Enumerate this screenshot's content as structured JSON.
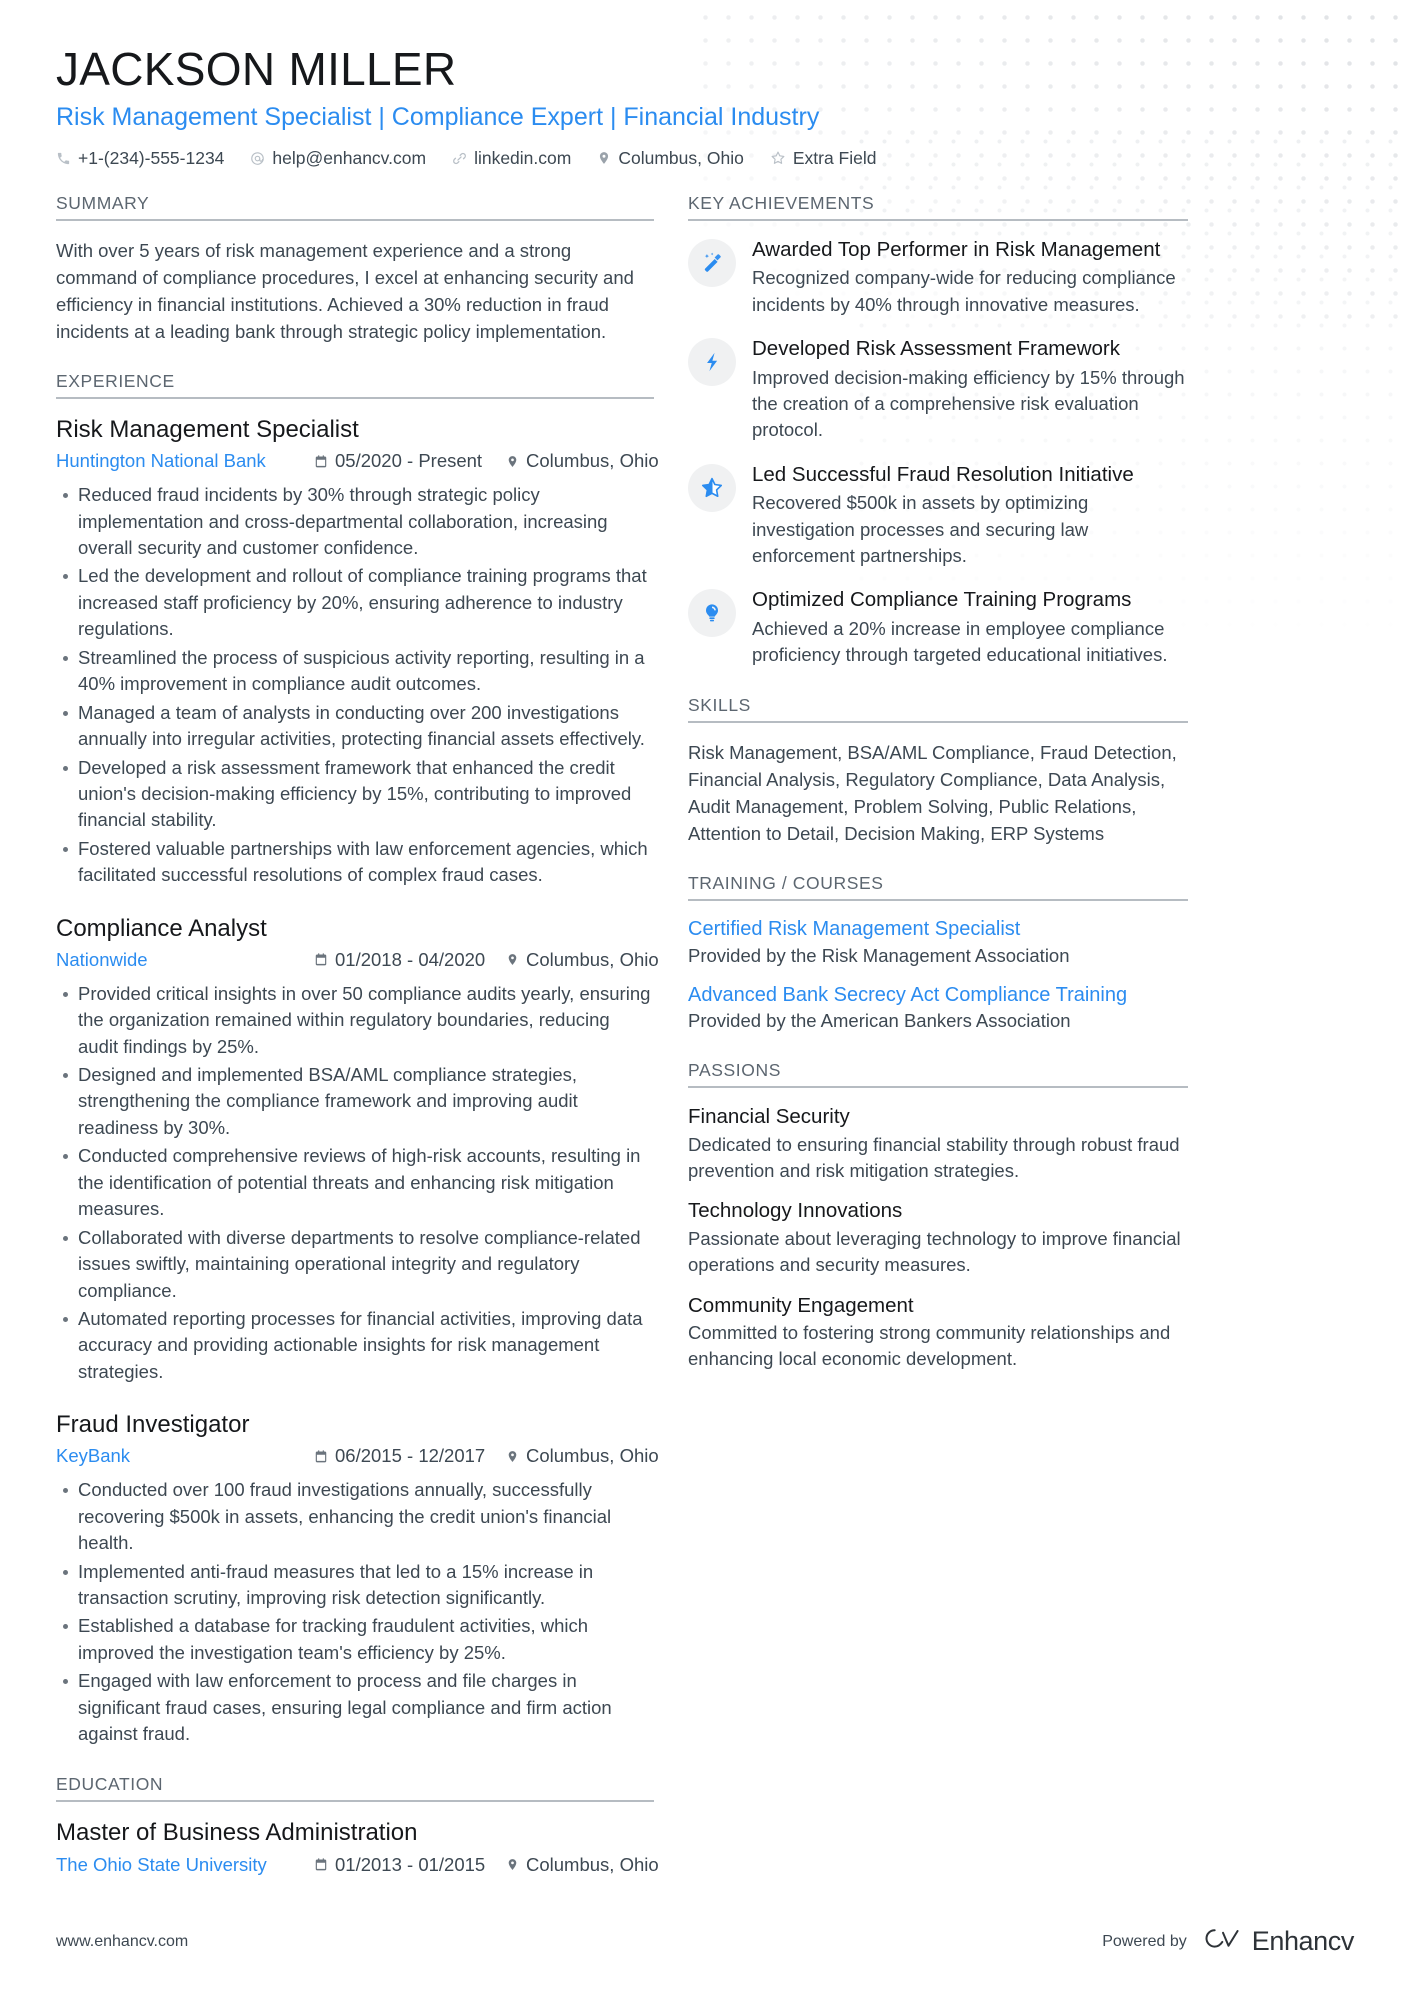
{
  "header": {
    "name": "JACKSON MILLER",
    "headline": "Risk Management Specialist | Compliance Expert | Financial Industry",
    "contacts": [
      {
        "icon": "phone-icon",
        "text": "+1-(234)-555-1234"
      },
      {
        "icon": "email-icon",
        "text": "help@enhancv.com"
      },
      {
        "icon": "link-icon",
        "text": "linkedin.com"
      },
      {
        "icon": "location-pin-icon",
        "text": "Columbus, Ohio"
      },
      {
        "icon": "star-outline-icon",
        "text": "Extra Field"
      }
    ]
  },
  "sections": {
    "summary": {
      "heading": "SUMMARY",
      "text": "With over 5 years of risk management experience and a strong command of compliance procedures, I excel at enhancing security and efficiency in financial institutions. Achieved a 30% reduction in fraud incidents at a leading bank through strategic policy implementation."
    },
    "experience": {
      "heading": "EXPERIENCE",
      "jobs": [
        {
          "title": "Risk Management Specialist",
          "company": "Huntington National Bank",
          "dates": "05/2020 - Present",
          "location": "Columbus, Ohio",
          "bullets": [
            "Reduced fraud incidents by 30% through strategic policy implementation and cross-departmental collaboration, increasing overall security and customer confidence.",
            "Led the development and rollout of compliance training programs that increased staff proficiency by 20%, ensuring adherence to industry regulations.",
            "Streamlined the process of suspicious activity reporting, resulting in a 40% improvement in compliance audit outcomes.",
            "Managed a team of analysts in conducting over 200 investigations annually into irregular activities, protecting financial assets effectively.",
            "Developed a risk assessment framework that enhanced the credit union's decision-making efficiency by 15%, contributing to improved financial stability.",
            "Fostered valuable partnerships with law enforcement agencies, which facilitated successful resolutions of complex fraud cases."
          ]
        },
        {
          "title": "Compliance Analyst",
          "company": "Nationwide",
          "dates": "01/2018 - 04/2020",
          "location": "Columbus, Ohio",
          "bullets": [
            "Provided critical insights in over 50 compliance audits yearly, ensuring the organization remained within regulatory boundaries, reducing audit findings by 25%.",
            "Designed and implemented BSA/AML compliance strategies, strengthening the compliance framework and improving audit readiness by 30%.",
            "Conducted comprehensive reviews of high-risk accounts, resulting in the identification of potential threats and enhancing risk mitigation measures.",
            "Collaborated with diverse departments to resolve compliance-related issues swiftly, maintaining operational integrity and regulatory compliance.",
            "Automated reporting processes for financial activities, improving data accuracy and providing actionable insights for risk management strategies."
          ]
        },
        {
          "title": "Fraud Investigator",
          "company": "KeyBank",
          "dates": "06/2015 - 12/2017",
          "location": "Columbus, Ohio",
          "bullets": [
            "Conducted over 100 fraud investigations annually, successfully recovering $500k in assets, enhancing the credit union's financial health.",
            "Implemented anti-fraud measures that led to a 15% increase in transaction scrutiny, improving risk detection significantly.",
            "Established a database for tracking fraudulent activities, which improved the investigation team's efficiency by 25%.",
            "Engaged with law enforcement to process and file charges in significant fraud cases, ensuring legal compliance and firm action against fraud."
          ]
        }
      ]
    },
    "education": {
      "heading": "EDUCATION",
      "entries": [
        {
          "degree": "Master of Business Administration",
          "school": "The Ohio State University",
          "dates": "01/2013 - 01/2015",
          "location": "Columbus, Ohio"
        }
      ]
    },
    "key_achievements": {
      "heading": "KEY ACHIEVEMENTS",
      "items": [
        {
          "icon": "magic-wand-icon",
          "title": "Awarded Top Performer in Risk Management",
          "description": "Recognized company-wide for reducing compliance incidents by 40% through innovative measures."
        },
        {
          "icon": "lightning-bolt-icon",
          "title": "Developed Risk Assessment Framework",
          "description": "Improved decision-making efficiency by 15% through the creation of a comprehensive risk evaluation protocol."
        },
        {
          "icon": "star-half-icon",
          "title": "Led Successful Fraud Resolution Initiative",
          "description": "Recovered $500k in assets by optimizing investigation processes and securing law enforcement partnerships."
        },
        {
          "icon": "lightbulb-icon",
          "title": "Optimized Compliance Training Programs",
          "description": "Achieved a 20% increase in employee compliance proficiency through targeted educational initiatives."
        }
      ]
    },
    "skills": {
      "heading": "SKILLS",
      "text": "Risk Management, BSA/AML Compliance, Fraud Detection, Financial Analysis, Regulatory Compliance, Data Analysis, Audit Management, Problem Solving, Public Relations, Attention to Detail, Decision Making, ERP Systems"
    },
    "training": {
      "heading": "TRAINING / COURSES",
      "items": [
        {
          "title": "Certified Risk Management Specialist",
          "provider": "Provided by the Risk Management Association"
        },
        {
          "title": "Advanced Bank Secrecy Act Compliance Training",
          "provider": "Provided by the American Bankers Association"
        }
      ]
    },
    "passions": {
      "heading": "PASSIONS",
      "items": [
        {
          "title": "Financial Security",
          "description": "Dedicated to ensuring financial stability through robust fraud prevention and risk mitigation strategies."
        },
        {
          "title": "Technology Innovations",
          "description": "Passionate about leveraging technology to improve financial operations and security measures."
        },
        {
          "title": "Community Engagement",
          "description": "Committed to fostering strong community relationships and enhancing local economic development."
        }
      ]
    }
  },
  "footer": {
    "url": "www.enhancv.com",
    "powered_by": "Powered by",
    "brand": "Enhancv"
  },
  "colors": {
    "accent": "#2b8cf0",
    "text": "#3d4852",
    "heading": "#16181b",
    "rule": "#b6bcc2"
  }
}
